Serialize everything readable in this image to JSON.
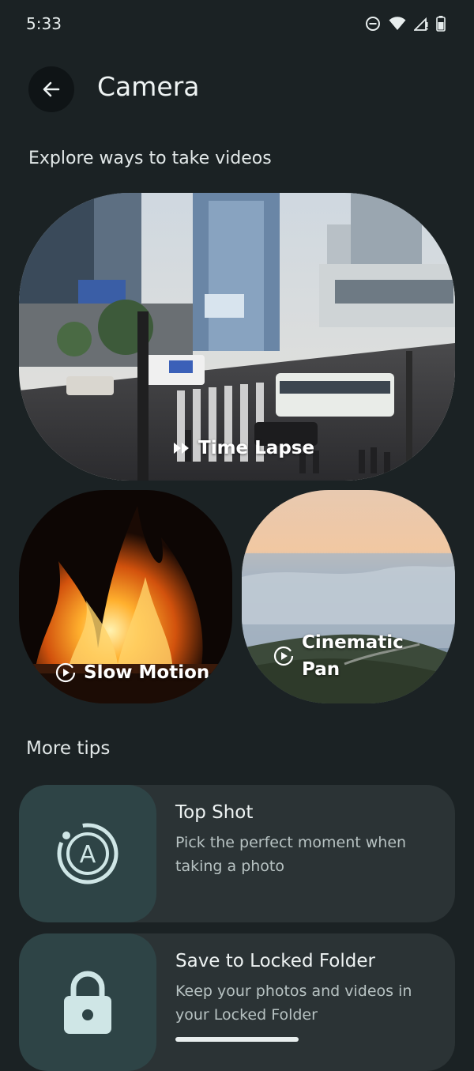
{
  "status_bar": {
    "time": "5:33",
    "icons": [
      "do-not-disturb-icon",
      "wifi-icon",
      "signal-icon",
      "battery-icon"
    ]
  },
  "header": {
    "title": "Camera",
    "back_icon": "arrow-left-icon"
  },
  "videos_section": {
    "heading": "Explore ways to take videos",
    "cards": [
      {
        "label": "Time Lapse",
        "icon": "fast-forward-icon"
      },
      {
        "label": "Slow Motion",
        "icon": "play-circle-icon"
      },
      {
        "label": "Cinematic Pan",
        "line1": "Cinematic",
        "line2": "Pan",
        "icon": "play-circle-icon"
      }
    ]
  },
  "tips_section": {
    "heading": "More tips",
    "items": [
      {
        "title": "Top Shot",
        "description": "Pick the perfect moment when taking a photo",
        "icon": "top-shot-icon"
      },
      {
        "title": "Save to Locked Folder",
        "description": "Keep your photos and videos in your Locked Folder",
        "icon": "lock-icon"
      }
    ]
  },
  "colors": {
    "background": "#1b2224",
    "card": "#2b3335",
    "icon_tile": "#2e4446",
    "icon_tint": "#cfe6e6"
  }
}
